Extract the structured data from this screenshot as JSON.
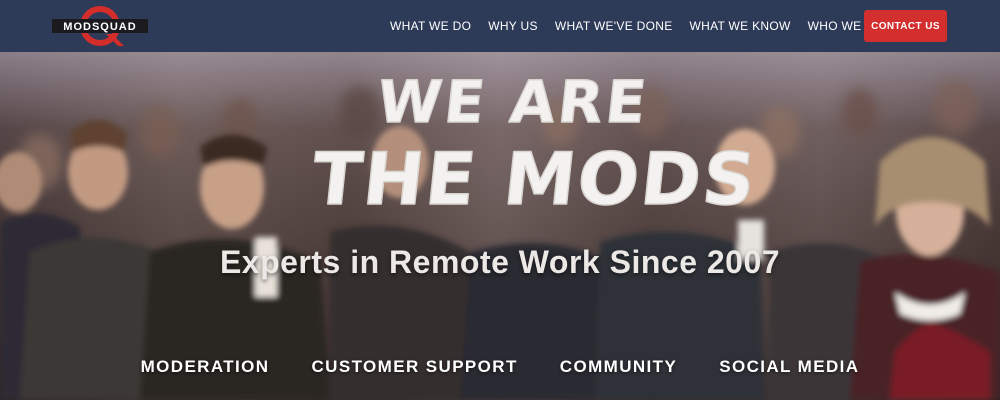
{
  "nav": {
    "logo_text": "MODSQUAD",
    "links": [
      {
        "label": "WHAT WE DO"
      },
      {
        "label": "WHY US"
      },
      {
        "label": "WHAT WE'VE DONE"
      },
      {
        "label": "WHAT WE KNOW"
      },
      {
        "label": "WHO WE ARE"
      }
    ],
    "contact_label": "CONTACT US"
  },
  "hero": {
    "headline_line1": "WE ARE",
    "headline_line2": "THE MODS",
    "tagline": "Experts in Remote Work Since 2007",
    "services": [
      {
        "label": "MODERATION"
      },
      {
        "label": "CUSTOMER SUPPORT"
      },
      {
        "label": "COMMUNITY"
      },
      {
        "label": "SOCIAL MEDIA"
      }
    ]
  },
  "colors": {
    "nav_background": "#2d3b59",
    "contact_button": "#d32f2f",
    "logo_red": "#d42d2a"
  }
}
